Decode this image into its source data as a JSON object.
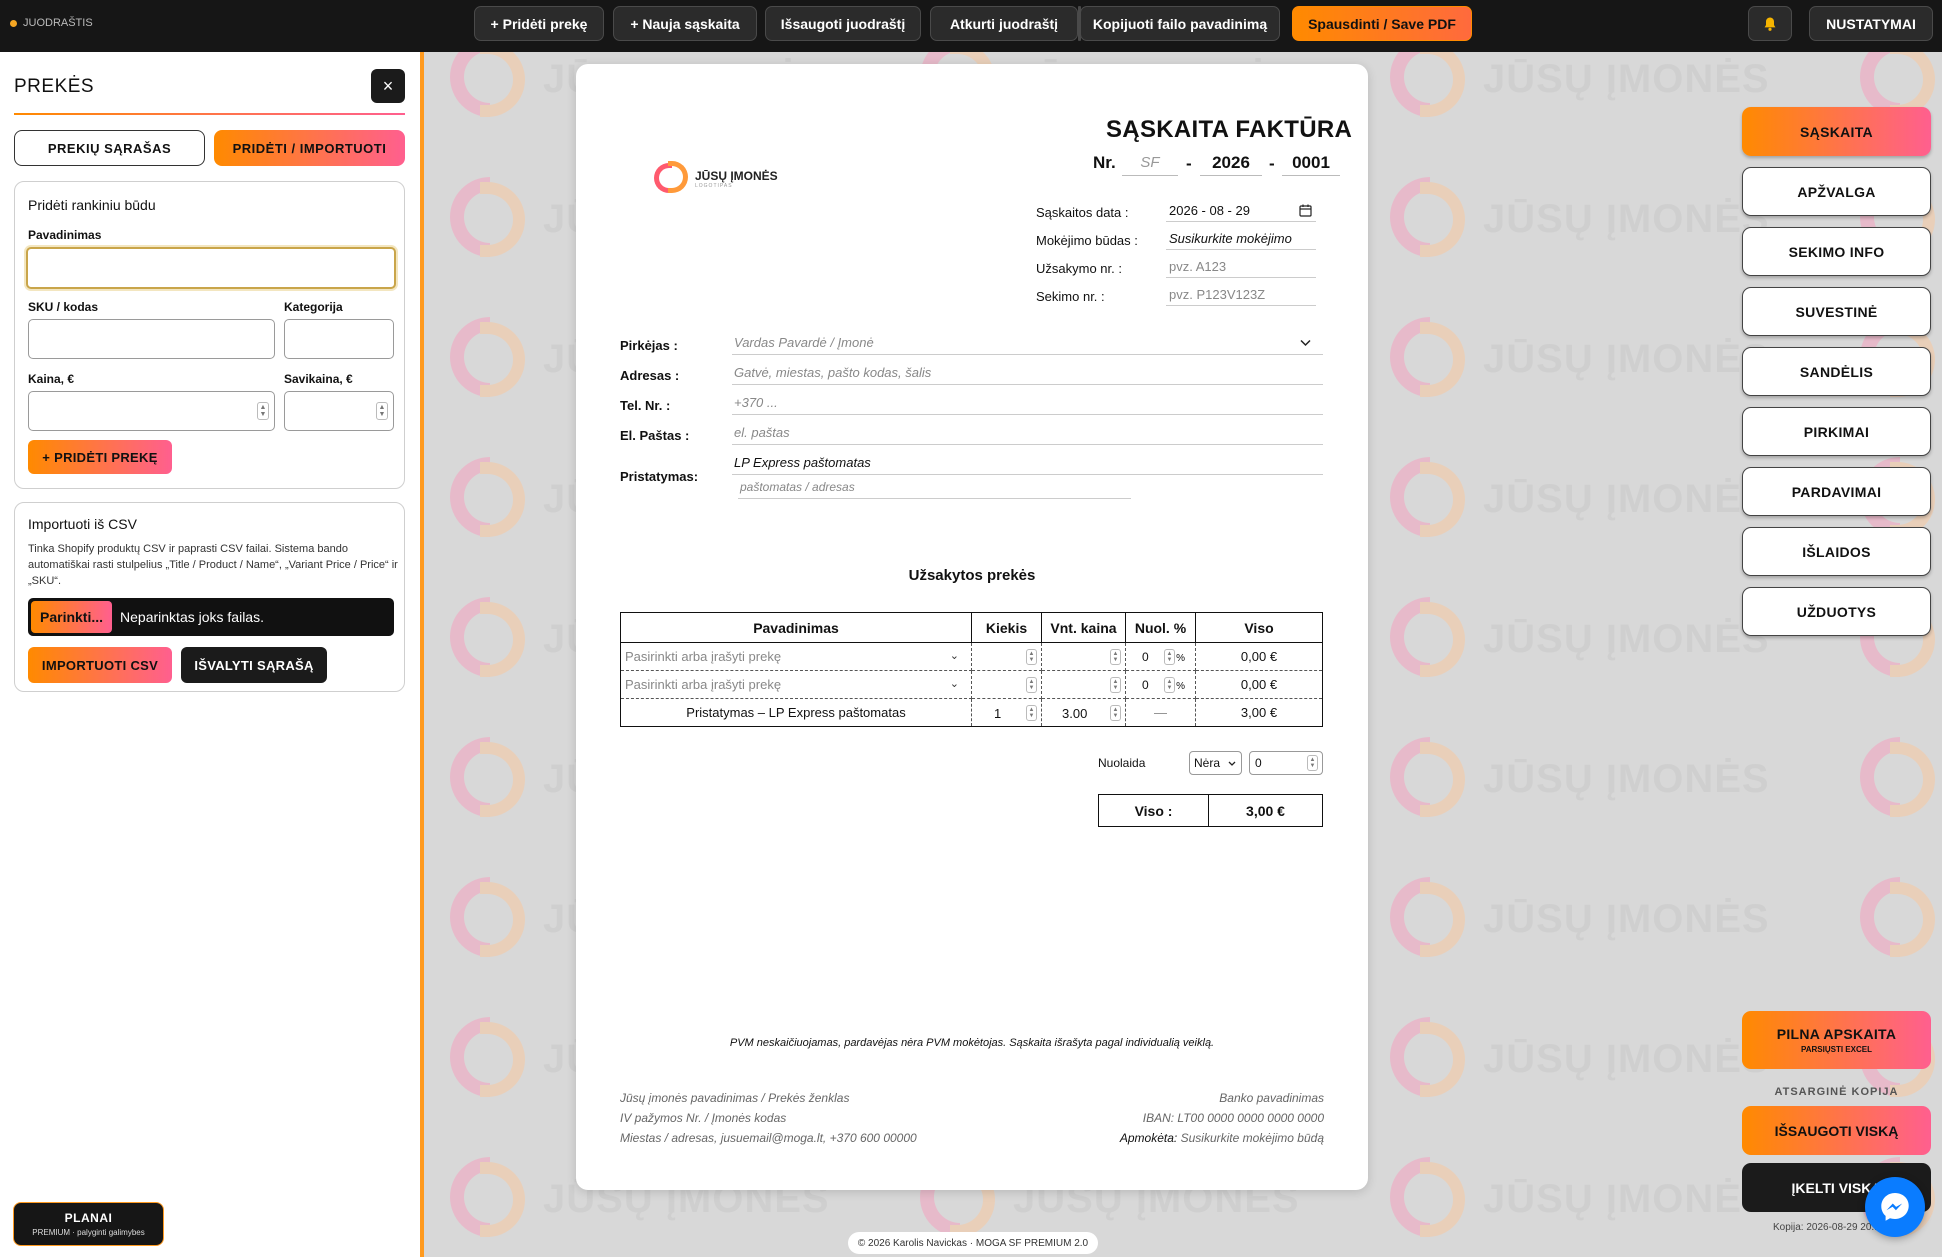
{
  "topbar": {
    "draft": "JUODRAŠTIS",
    "buttons": [
      "+ Pridėti prekę",
      "+ Nauja sąskaita",
      "Išsaugoti juodraštį",
      "Atkurti juodraštį",
      "Kopijuoti failo pavadinimą",
      "Spausdinti / Save PDF"
    ],
    "settings": "NUSTATYMAI",
    "bell_icon": "bell-icon"
  },
  "watermark": {
    "text": "JŪSŲ ĮMONĖS"
  },
  "left_panel": {
    "title": "PREKĖS",
    "close": "×",
    "tabs": [
      "PREKIŲ SĄRAŠAS",
      "PRIDĖTI / IMPORTUOTI"
    ],
    "manual": {
      "heading": "Pridėti rankiniu būdu",
      "name_label": "Pavadinimas",
      "sku_label": "SKU / kodas",
      "category_label": "Kategorija",
      "price_label": "Kaina, €",
      "cost_label": "Savikaina, €",
      "add_button": "+ PRIDĖTI PREKĘ"
    },
    "csv": {
      "heading": "Importuoti iš CSV",
      "description": "Tinka Shopify produktų CSV ir paprasti CSV failai. Sistema bando automatiškai rasti stulpelius „Title / Product / Name“, „Variant Price / Price“ ir „SKU“.",
      "choose": "Parinkti...",
      "no_file": "Neparinktas joks failas.",
      "import_button": "IMPORTUOTI CSV",
      "clear_button": "IŠVALYTI SĄRAŠĄ"
    },
    "plans": {
      "title": "PLANAI",
      "subtitle": "PREMIUM · palyginti galimybes"
    }
  },
  "invoice": {
    "title": "SĄSKAITA FAKTŪRA",
    "nr_label": "Nr.",
    "series": "SF",
    "year": "2026",
    "number": "0001",
    "dash": "-",
    "logo": {
      "name": "JŪSŲ ĮMONĖS",
      "sub": "LOGOTIPAS"
    },
    "date_label": "Sąskaitos data :",
    "date_value": "2026 - 08 - 29",
    "payment_label": "Mokėjimo būdas :",
    "payment_value": "Susikurkite mokėjimo",
    "order_label": "Užsakymo nr. :",
    "order_placeholder": "pvz. A123",
    "tracking_label": "Sekimo nr. :",
    "tracking_placeholder": "pvz. P123V123Z",
    "buyer_label": "Pirkėjas :",
    "buyer_placeholder": "Vardas Pavardė / Įmonė",
    "address_label": "Adresas :",
    "address_placeholder": "Gatvė, miestas, pašto kodas, šalis",
    "phone_label": "Tel. Nr. :",
    "phone_placeholder": "+370 ...",
    "email_label": "El. Paštas :",
    "email_placeholder": "el. paštas",
    "delivery_label": "Pristatymas:",
    "delivery_value": "LP Express paštomatas",
    "delivery_placeholder": "paštomatas / adresas",
    "ordered_heading": "Užsakytos prekės",
    "table": {
      "headers": [
        "Pavadinimas",
        "Kiekis",
        "Vnt. kaina",
        "Nuol. %",
        "Viso"
      ],
      "rows": [
        {
          "name": "Pasirinkti arba įrašyti prekę",
          "qty": "",
          "price": "",
          "disc": "0",
          "pct": "%",
          "total": "0,00 €"
        },
        {
          "name": "Pasirinkti arba įrašyti prekę",
          "qty": "",
          "price": "",
          "disc": "0",
          "pct": "%",
          "total": "0,00 €"
        },
        {
          "name": "Pristatymas – LP Express paštomatas",
          "qty": "1",
          "price": "3.00",
          "disc": "—",
          "total": "3,00 €"
        }
      ]
    },
    "discount_label": "Nuolaida",
    "discount_type": "Nėra",
    "discount_value": "0",
    "total_label": "Viso :",
    "total_value": "3,00 €",
    "vat_note": "PVM neskaičiuojamas, pardavėjas nėra PVM mokėtojas. Sąskaita išrašyta pagal individualią veiklą.",
    "footer_left": [
      "Jūsų įmonės pavadinimas / Prekės ženklas",
      "IV pažymos Nr. / Įmonės kodas",
      "Miestas / adresas, jusuemail@moga.lt, +370 600 00000"
    ],
    "footer_right": [
      "Banko pavadinimas",
      "IBAN: LT00 0000 0000 0000 0000"
    ],
    "paid_label": "Apmokėta:",
    "paid_value": "Susikurkite mokėjimo būdą"
  },
  "copyright": "© 2026 Karolis Navickas · MOGA SF PREMIUM 2.0",
  "right_nav": {
    "items": [
      "SĄSKAITA",
      "APŽVALGA",
      "SEKIMO INFO",
      "SUVESTINĖ",
      "SANDĖLIS",
      "PIRKIMAI",
      "PARDAVIMAI",
      "IŠLAIDOS",
      "UŽDUOTYS"
    ],
    "full_accounting": "PILNA APSKAITA",
    "full_accounting_sub": "PARSIŲSTI EXCEL",
    "backup_label": "ATSARGINĖ KOPIJA",
    "save_all": "IŠSAUGOTI VISKĄ",
    "load_all": "ĮKELTI VISKĄ",
    "copy_date": "Kopija: 2026-08-29 20..."
  },
  "colors": {
    "accent_start": "#ff8a00",
    "accent_end": "#ff5f8f",
    "dark": "#161616",
    "messenger": "#0a7cff"
  },
  "icons": {
    "calendar": "calendar-icon",
    "chevron": "chevron-down-icon",
    "messenger": "messenger-icon"
  }
}
